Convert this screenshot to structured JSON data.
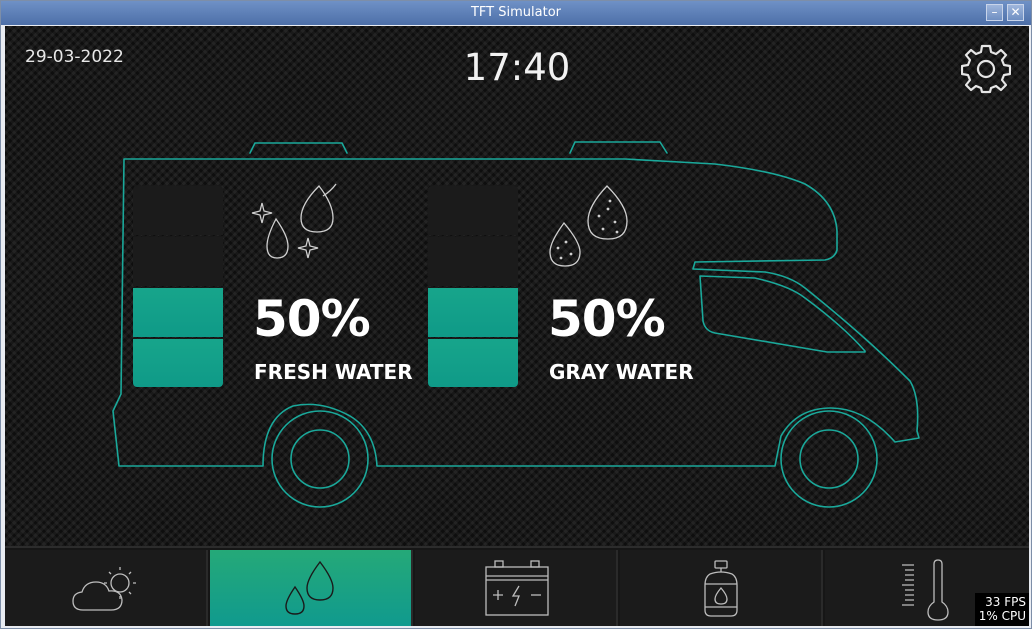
{
  "window": {
    "title": "TFT Simulator",
    "minimize_icon": "minimize-icon",
    "close_icon": "close-icon"
  },
  "header": {
    "date": "29-03-2022",
    "time": "17:40",
    "settings_icon": "gear-icon"
  },
  "tanks": [
    {
      "percent_label": "50%",
      "name": "FRESH WATER",
      "level": 0.5,
      "segments": 4,
      "icon": "fresh-water-drops-icon"
    },
    {
      "percent_label": "50%",
      "name": "GRAY WATER",
      "level": 0.5,
      "segments": 4,
      "icon": "gray-water-drops-icon"
    }
  ],
  "colors": {
    "accent": "#10a08c",
    "van_outline": "#1aa89a",
    "nav_active_top": "#25a978",
    "nav_active_bottom": "#109a8e"
  },
  "navbar": {
    "items": [
      {
        "icon": "weather-icon",
        "active": false
      },
      {
        "icon": "water-icon",
        "active": true
      },
      {
        "icon": "battery-icon",
        "active": false
      },
      {
        "icon": "gas-bottle-icon",
        "active": false
      },
      {
        "icon": "thermometer-icon",
        "active": false
      }
    ]
  },
  "stats": {
    "fps": "33 FPS",
    "cpu": "1% CPU"
  }
}
